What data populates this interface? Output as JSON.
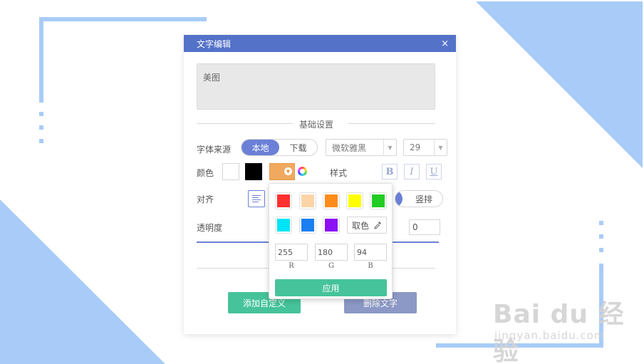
{
  "dialog": {
    "title": "文字编辑",
    "close_icon": "×",
    "text_value": "美图",
    "section_title": "基础设置",
    "font_source_label": "字体来源",
    "font_source_local": "本地",
    "font_source_download": "下载",
    "font_family": "微软雅黑",
    "font_size": "29",
    "color_label": "颜色",
    "style_label": "样式",
    "bold": "B",
    "italic": "I",
    "underline": "U",
    "align_label": "对齐",
    "vertical_label": "竖排",
    "opacity_label": "透明度",
    "opacity_value": "0",
    "add_button": "添加自定义",
    "delete_button": "删除文字",
    "selected_color": "#f0a95e"
  },
  "color_popup": {
    "colors": [
      "#ff3030",
      "#fcd4a8",
      "#ff8c1a",
      "#ffff00",
      "#22cc22",
      "#00e5f5",
      "#1a7ff0",
      "#8b10f5"
    ],
    "pick_label": "取色",
    "r": "255",
    "g": "180",
    "b": "94",
    "r_label": "R",
    "g_label": "G",
    "b_label": "B",
    "apply": "应用"
  },
  "watermark": {
    "brand": "Bai du 经验",
    "url": "jingyan.baidu.com"
  },
  "theme": {
    "accent": "#5572c9",
    "green": "#46c39a",
    "deco_blue": "#a8ccf7"
  }
}
